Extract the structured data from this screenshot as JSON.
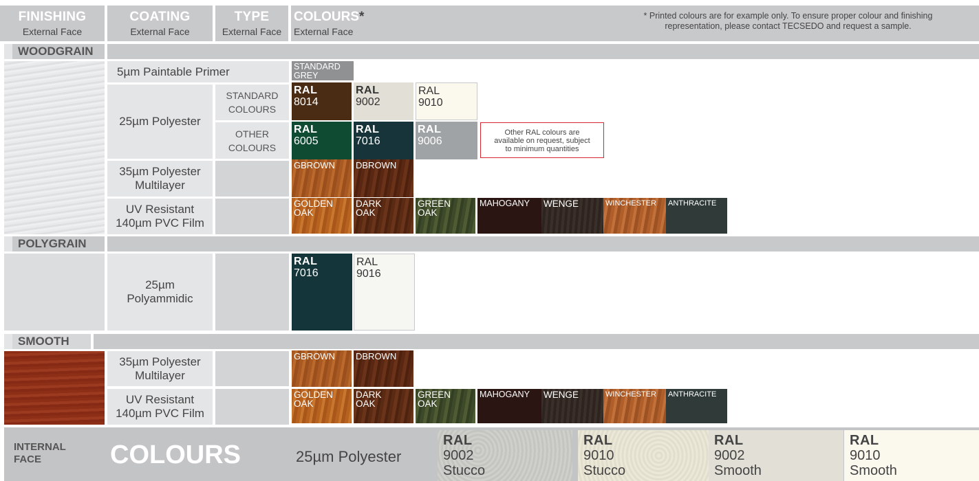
{
  "header": {
    "finishing": {
      "title": "FINISHING",
      "sub": "External Face"
    },
    "coating": {
      "title": "COATING",
      "sub": "External Face"
    },
    "type": {
      "title": "TYPE",
      "sub": "External Face"
    },
    "colours": {
      "title": "COLOURS",
      "asterisk": "*",
      "sub": "External Face"
    },
    "note_line1": "* Printed colours are for example only. To ensure proper colour and finishing",
    "note_line2": "representation, please contact TECSEDO and request a sample."
  },
  "woodgrain": {
    "label": "WOODGRAIN",
    "primer": {
      "coating": "5µm Paintable Primer",
      "swatch_line1": "STANDARD",
      "swatch_line2": "GREY"
    },
    "polyester": {
      "coating": "25µm Polyester",
      "standard_type_line1": "STANDARD",
      "standard_type_line2": "COLOURS",
      "other_type_line1": "OTHER",
      "other_type_line2": "COLOURS",
      "standard": [
        {
          "prefix": "RAL",
          "code": "8014",
          "color": "#4a2c14"
        },
        {
          "prefix": "RAL",
          "code": "9002",
          "color": "#e2e0d6"
        },
        {
          "prefix": "RAL",
          "code": "9010",
          "color": "#fbf8ee"
        }
      ],
      "other": [
        {
          "prefix": "RAL",
          "code": "6005",
          "color": "#0f4a33"
        },
        {
          "prefix": "RAL",
          "code": "7016",
          "color": "#17343a"
        },
        {
          "prefix": "RAL",
          "code": "9006",
          "color": "#a0a3a5"
        }
      ],
      "other_note_line1": "Other RAL colours are",
      "other_note_line2": "available on request, subject",
      "other_note_line3": "to minimum quantities"
    },
    "multilayer": {
      "coating_line1": "35µm Polyester",
      "coating_line2": "Multilayer",
      "swatches": [
        "GBROWN",
        "DBROWN"
      ]
    },
    "pvc": {
      "coating_line1": "UV Resistant",
      "coating_line2": "140µm PVC Film",
      "swatches": [
        {
          "line1": "GOLDEN",
          "line2": "OAK"
        },
        {
          "line1": "DARK",
          "line2": "OAK"
        },
        {
          "line1": "GREEN",
          "line2": "OAK"
        },
        {
          "line1": "MAHOGANY",
          "line2": ""
        },
        {
          "line1": "WENGE",
          "line2": ""
        },
        {
          "line1": "WINCHESTER",
          "line2": ""
        },
        {
          "line1": "ANTHRACITE",
          "line2": ""
        }
      ]
    }
  },
  "polygrain": {
    "label": "POLYGRAIN",
    "coating_line1": "25µm",
    "coating_line2": "Polyammidic",
    "swatches": [
      {
        "prefix": "RAL",
        "code": "7016",
        "color": "#14353a"
      },
      {
        "prefix": "RAL",
        "code": "9016",
        "color": "#f6f6f2"
      }
    ]
  },
  "smooth": {
    "label": "SMOOTH",
    "multilayer": {
      "coating_line1": "35µm Polyester",
      "coating_line2": "Multilayer",
      "swatches": [
        "GBROWN",
        "DBROWN"
      ]
    },
    "pvc": {
      "coating_line1": "UV Resistant",
      "coating_line2": "140µm PVC Film",
      "swatches": [
        {
          "line1": "GOLDEN",
          "line2": "OAK"
        },
        {
          "line1": "DARK",
          "line2": "OAK"
        },
        {
          "line1": "GREEN",
          "line2": "OAK"
        },
        {
          "line1": "MAHOGANY",
          "line2": ""
        },
        {
          "line1": "WENGE",
          "line2": ""
        },
        {
          "line1": "WINCHESTER",
          "line2": ""
        },
        {
          "line1": "ANTHRACITE",
          "line2": ""
        }
      ]
    }
  },
  "footer": {
    "internal_line1": "INTERNAL",
    "internal_line2": "FACE",
    "colours": "COLOURS",
    "coating": "25µm Polyester",
    "swatches": [
      {
        "prefix": "RAL",
        "code": "9002",
        "finish": "Stucco"
      },
      {
        "prefix": "RAL",
        "code": "9010",
        "finish": "Stucco"
      },
      {
        "prefix": "RAL",
        "code": "9002",
        "finish": "Smooth"
      },
      {
        "prefix": "RAL",
        "code": "9010",
        "finish": "Smooth"
      }
    ]
  }
}
